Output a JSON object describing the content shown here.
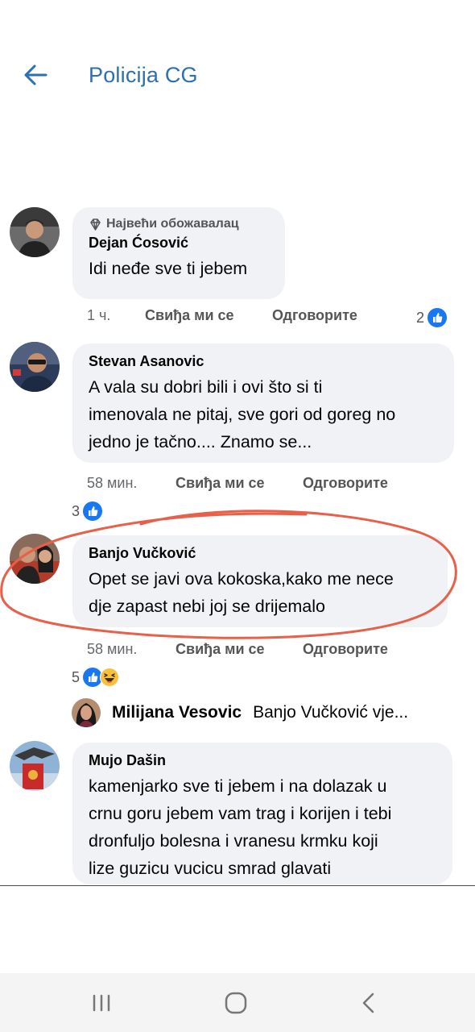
{
  "header": {
    "title": "Policija CG"
  },
  "comments": [
    {
      "badge": "Највећи обожавалац",
      "author": "Dejan Ćosović",
      "text": "Idi neđe sve ti jebem",
      "time": "1 ч.",
      "like_label": "Свиђа ми се",
      "reply_label": "Одговорите",
      "reaction_count": "2"
    },
    {
      "author": "Stevan Asanovic",
      "text": "A vala su dobri bili i ovi što si ti\nimenovala ne pitaj, sve gori od goreg no\njedno je tačno.... Znamo se...",
      "time": "58 мин.",
      "like_label": "Свиђа ми се",
      "reply_label": "Одговорите",
      "reaction_count": "3"
    },
    {
      "author": "Banjo Vučković",
      "text": "Opet se javi ova kokoska,kako me nece\ndje zapast nebi joj se drijemalo",
      "time": "58 мин.",
      "like_label": "Свиђа ми се",
      "reply_label": "Одговорите",
      "reaction_count": "5"
    },
    {
      "author": "Mujo Dašin",
      "text": "kamenjarko sve ti jebem i na dolazak u\ncrnu goru jebem vam trag i korijen i tebi\ndronfuljo bolesna i vranesu krmku koji\nlize guzicu vucicu smrad glavati"
    }
  ],
  "reply_preview": {
    "author": "Milijana Vesovic",
    "text": "Banjo Vučković vje..."
  },
  "colors": {
    "accent": "#2c6fb3",
    "like_blue": "#1877f2",
    "bubble": "#f0f2f5",
    "annotation": "#e8604a"
  },
  "icons": {
    "back": "arrow-left-icon",
    "badge": "diamond-icon",
    "like": "thumbs-up-icon",
    "haha": "laughing-face-icon",
    "recents": "recent-apps-icon",
    "home": "home-icon",
    "nav_back": "chevron-left-icon"
  }
}
